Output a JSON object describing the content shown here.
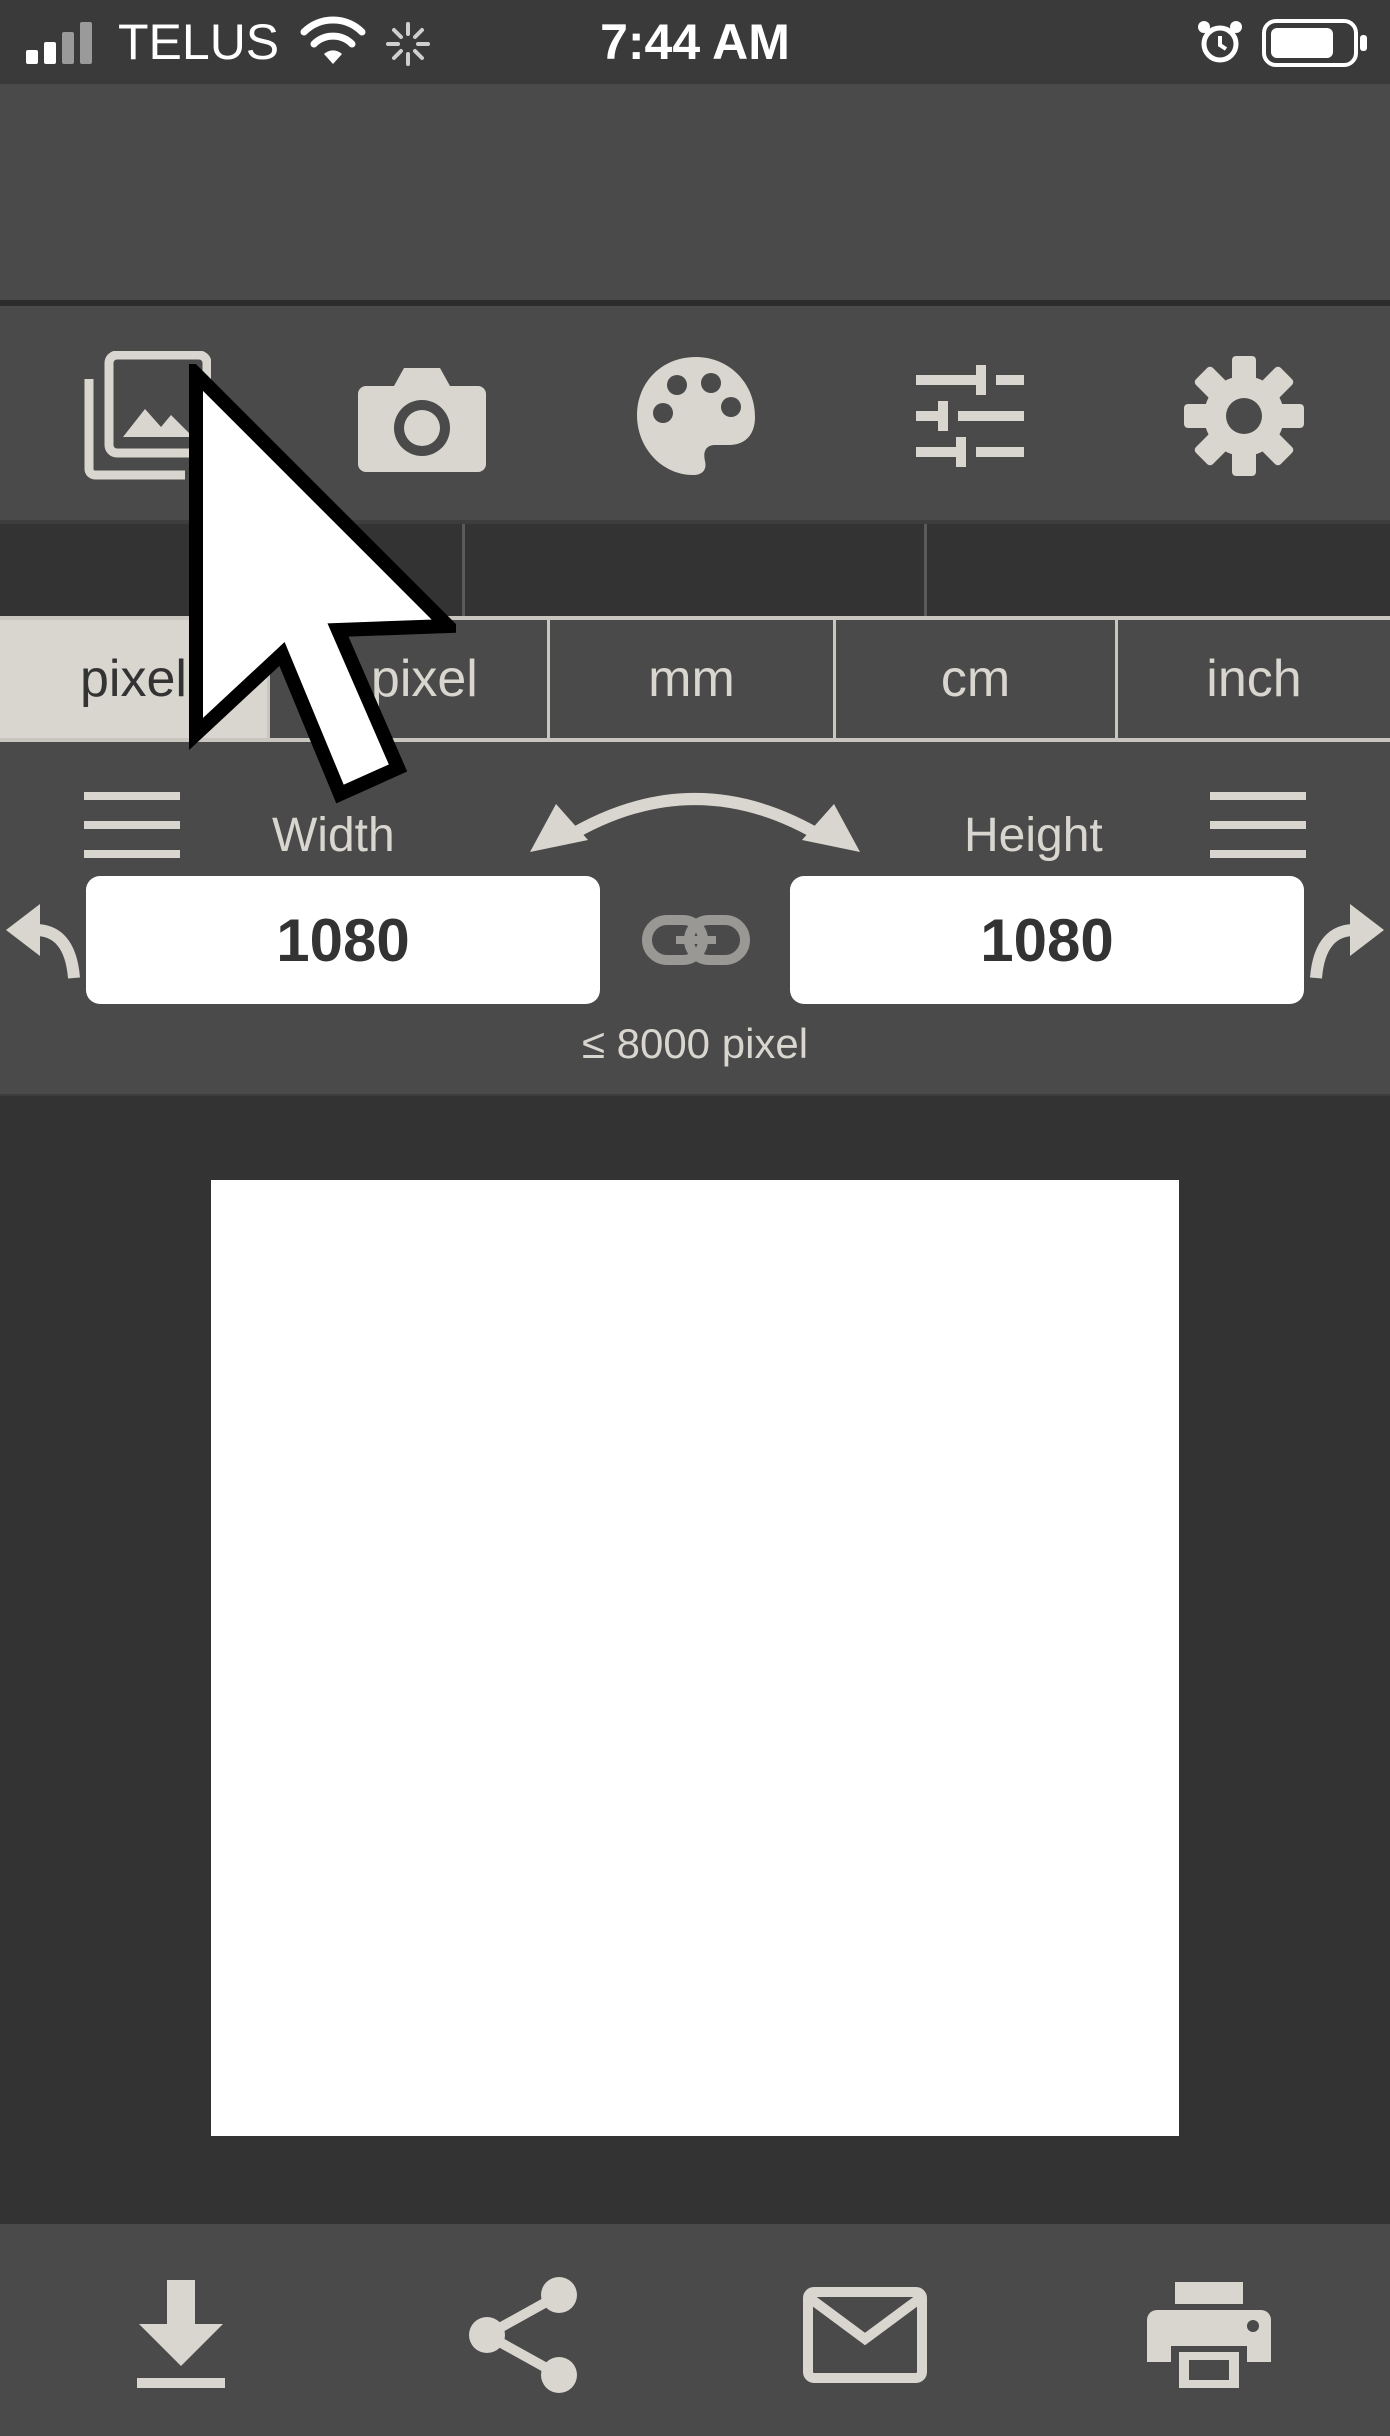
{
  "status": {
    "carrier": "TELUS",
    "time": "7:44 AM"
  },
  "toolbar": {
    "icons": [
      "photo-library-icon",
      "camera-icon",
      "palette-icon",
      "sliders-icon",
      "gear-icon"
    ]
  },
  "unit_tabs": [
    {
      "label": "pixel",
      "active": true
    },
    {
      "label": "r pixel",
      "active": false
    },
    {
      "label": "mm",
      "active": false
    },
    {
      "label": "cm",
      "active": false
    },
    {
      "label": "inch",
      "active": false
    }
  ],
  "size": {
    "width_label": "Width",
    "height_label": "Height",
    "width_value": "1080",
    "height_value": "1080",
    "limit_text": "≤ 8000 pixel"
  },
  "bottom_bar": {
    "icons": [
      "download-icon",
      "share-icon",
      "mail-icon",
      "print-icon"
    ]
  },
  "colors": {
    "accent": "#d9d6cf",
    "background": "#4a4a4a",
    "canvas": "#ffffff"
  }
}
